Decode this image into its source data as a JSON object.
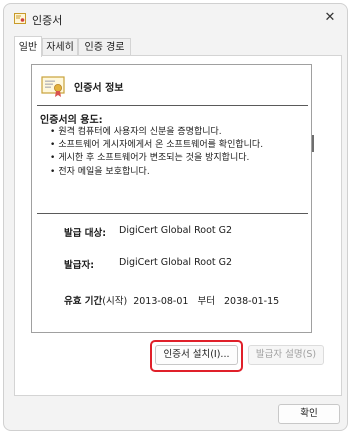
{
  "window": {
    "title": "인증서",
    "close_glyph": "✕"
  },
  "tabs": [
    {
      "label": "일반",
      "active": true
    },
    {
      "label": "자세히",
      "active": false
    },
    {
      "label": "인증 경로",
      "active": false
    }
  ],
  "certificate": {
    "info_title": "인증서 정보",
    "purpose_heading": "인증서의 용도:",
    "purposes": [
      "원격 컴퓨터에 사용자의 신분을 증명합니다.",
      "소프트웨어 게시자에게서 온 소프트웨어를 확인합니다.",
      "게시한 후 소프트웨어가 변조되는 것을 방지합니다.",
      "전자 메일을 보호합니다."
    ],
    "issued_to_label": "발급 대상:",
    "issued_to_value": "DigiCert Global Root G2",
    "issued_by_label": "발급자:",
    "issued_by_value": "DigiCert Global Root G2",
    "validity_label": "유효 기간",
    "validity_from_label": "(시작)",
    "valid_from": "2013-08-01",
    "validity_to_label": "부터",
    "valid_to": "2038-01-15"
  },
  "buttons": {
    "install": "인증서 설치(I)...",
    "issuer_statement": "발급자 설명(S)",
    "ok": "확인"
  },
  "colors": {
    "highlight": "#e0202a",
    "window_bg": "#f3f3f3",
    "panel_bg": "#ffffff"
  },
  "icons": {
    "title": "certificate-icon",
    "info": "certificate-icon",
    "close": "close-icon"
  }
}
